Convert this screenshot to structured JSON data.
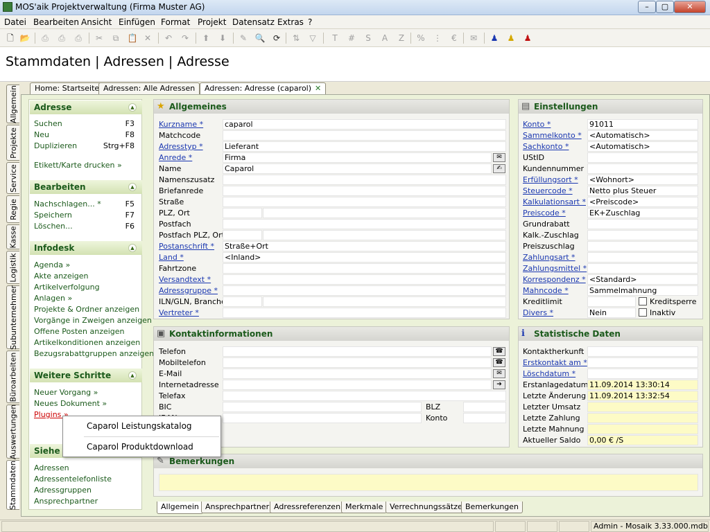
{
  "window": {
    "title": "MOS'aik Projektverwaltung (Firma Muster AG)"
  },
  "menu": [
    "Datei",
    "Bearbeiten",
    "Ansicht",
    "Einfügen",
    "Format",
    "Projekt",
    "Datensatz",
    "Extras",
    "?"
  ],
  "page_title": "Stammdaten | Adressen | Adresse",
  "doc_tabs": [
    {
      "label": "Home: Startseite"
    },
    {
      "label": "Adressen: Alle Adressen"
    },
    {
      "label": "Adressen: Adresse (caparol)"
    }
  ],
  "side_tabs": [
    "Allgemein",
    "Projekte",
    "Service",
    "Regie",
    "Kasse",
    "Logistik",
    "Subunternehmer",
    "Büroarbeiten",
    "Auswertungen",
    "Stammdaten"
  ],
  "nav": {
    "adresse": {
      "title": "Adresse",
      "items": [
        {
          "label": "Suchen",
          "key": "F3"
        },
        {
          "label": "Neu",
          "key": "F8"
        },
        {
          "label": "Duplizieren",
          "key": "Strg+F8"
        },
        {
          "label": "Etikett/Karte drucken »",
          "key": ""
        }
      ]
    },
    "bearbeiten": {
      "title": "Bearbeiten",
      "items": [
        {
          "label": "Nachschlagen... *",
          "key": "F5"
        },
        {
          "label": "Speichern",
          "key": "F7"
        },
        {
          "label": "Löschen...",
          "key": "F6"
        }
      ]
    },
    "infodesk": {
      "title": "Infodesk",
      "items": [
        "Agenda »",
        "Akte anzeigen",
        "Artikelverfolgung",
        "Anlagen »",
        "Projekte & Ordner anzeigen",
        "Vorgänge in Zweigen anzeigen",
        "Offene Posten anzeigen",
        "Artikelkonditionen anzeigen",
        "Bezugsrabattgruppen anzeigen"
      ]
    },
    "weitere": {
      "title": "Weitere Schritte",
      "items": [
        "Neuer Vorgang »",
        "Neues Dokument »",
        "Plugins »"
      ]
    },
    "siehe": {
      "title": "Siehe a",
      "items": [
        "Adressen",
        "Adressentelefonliste",
        "Adressgruppen",
        "Ansprechpartner"
      ]
    }
  },
  "context_menu": [
    "Caparol Leistungskatalog",
    "Caparol Produktdownload"
  ],
  "allgemeines": {
    "title": "Allgemeines",
    "fields": [
      {
        "label": "Kurzname *",
        "value": "caparol",
        "link": true
      },
      {
        "label": "Matchcode",
        "value": "",
        "link": false
      },
      {
        "label": "Adresstyp *",
        "value": "Lieferant",
        "link": true
      },
      {
        "label": "Anrede *",
        "value": "Firma",
        "link": true
      },
      {
        "label": "Name",
        "value": "Caparol",
        "link": false
      },
      {
        "label": "Namenszusatz",
        "value": "",
        "link": false
      },
      {
        "label": "Briefanrede",
        "value": "",
        "link": false
      },
      {
        "label": "Straße",
        "value": "",
        "link": false
      },
      {
        "label": "PLZ, Ort",
        "value": "",
        "link": false
      },
      {
        "label": "Postfach",
        "value": "",
        "link": false
      },
      {
        "label": "Postfach PLZ, Ort",
        "value": "",
        "link": false
      },
      {
        "label": "Postanschrift *",
        "value": "Straße+Ort",
        "link": true
      },
      {
        "label": "Land *",
        "value": "<Inland>",
        "link": true
      },
      {
        "label": "Fahrtzone",
        "value": "",
        "link": false
      },
      {
        "label": "Versandtext *",
        "value": "",
        "link": true
      },
      {
        "label": "Adressgruppe *",
        "value": "",
        "link": true
      },
      {
        "label": "ILN/GLN, Branche",
        "value": "",
        "link": false
      },
      {
        "label": "Vertreter *",
        "value": "",
        "link": true
      }
    ]
  },
  "einstellungen": {
    "title": "Einstellungen",
    "fields": [
      {
        "label": "Konto *",
        "value": "91011",
        "link": true
      },
      {
        "label": "Sammelkonto *",
        "value": "<Automatisch>",
        "link": true
      },
      {
        "label": "Sachkonto *",
        "value": "<Automatisch>",
        "link": true
      },
      {
        "label": "UStID",
        "value": "",
        "link": false
      },
      {
        "label": "Kundennummer",
        "value": "",
        "link": false
      },
      {
        "label": "Erfüllungsort *",
        "value": "<Wohnort>",
        "link": true
      },
      {
        "label": "Steuercode *",
        "value": "Netto plus Steuer",
        "link": true
      },
      {
        "label": "Kalkulationsart *",
        "value": "<Preiscode>",
        "link": true
      },
      {
        "label": "Preiscode *",
        "value": "EK+Zuschlag",
        "link": true
      },
      {
        "label": "Grundrabatt",
        "value": "",
        "link": false
      },
      {
        "label": "Kalk.-Zuschlag",
        "value": "",
        "link": false
      },
      {
        "label": "Preiszuschlag",
        "value": "",
        "link": false
      },
      {
        "label": "Zahlungsart *",
        "value": "",
        "link": true
      },
      {
        "label": "Zahlungsmittel *",
        "value": "",
        "link": true
      },
      {
        "label": "Korrespondenz *",
        "value": "<Standard>",
        "link": true
      },
      {
        "label": "Mahncode *",
        "value": "Sammelmahnung",
        "link": true
      },
      {
        "label": "Kreditlimit",
        "value": "",
        "link": false
      },
      {
        "label": "Divers *",
        "value": "Nein",
        "link": true
      }
    ],
    "checks": [
      "Kreditsperre",
      "Inaktiv"
    ]
  },
  "kontakt": {
    "title": "Kontaktinformationen",
    "fields": [
      {
        "label": "Telefon",
        "value": ""
      },
      {
        "label": "Mobiltelefon",
        "value": ""
      },
      {
        "label": "E-Mail",
        "value": ""
      },
      {
        "label": "Internetadresse",
        "value": ""
      },
      {
        "label": "Telefax",
        "value": ""
      },
      {
        "label": "BIC",
        "value": ""
      },
      {
        "label": "IBAN",
        "value": ""
      }
    ],
    "blz": "BLZ",
    "konto": "Konto"
  },
  "statistik": {
    "title": "Statistische Daten",
    "fields": [
      {
        "label": "Kontaktherkunft",
        "value": "",
        "link": false
      },
      {
        "label": "Erstkontakt am *",
        "value": "",
        "link": true
      },
      {
        "label": "Löschdatum *",
        "value": "",
        "link": true
      },
      {
        "label": "Erstanlagedatum",
        "value": "11.09.2014 13:30:14",
        "link": false
      },
      {
        "label": "Letzte Änderung",
        "value": "11.09.2014 13:32:54",
        "link": false
      },
      {
        "label": "Letzter Umsatz",
        "value": "",
        "link": false
      },
      {
        "label": "Letzte Zahlung",
        "value": "",
        "link": false
      },
      {
        "label": "Letzte Mahnung",
        "value": "",
        "link": false
      },
      {
        "label": "Aktueller Saldo",
        "value": "0,00 € /S",
        "link": false
      }
    ]
  },
  "bemerkungen": {
    "title": "Bemerkungen",
    "text": ""
  },
  "bottom_tabs": [
    "Allgemein",
    "Ansprechpartner",
    "Adressreferenzen",
    "Merkmale",
    "Verrechnungssätze",
    "Bemerkungen"
  ],
  "status": {
    "text": "Admin - Mosaik 3.33.000.mdb"
  }
}
